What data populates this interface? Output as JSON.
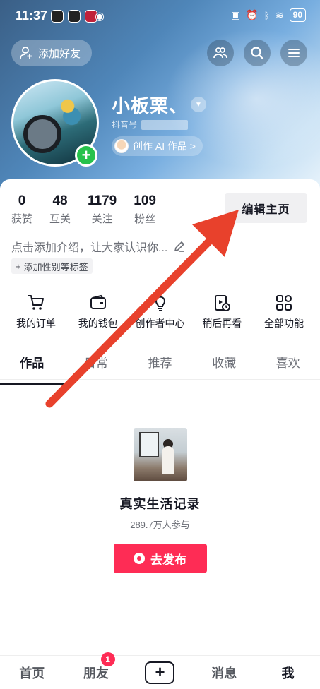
{
  "status_bar": {
    "time": "11:37",
    "battery": "90"
  },
  "header": {
    "add_friend_label": "添加好友"
  },
  "profile": {
    "nickname": "小板栗、",
    "douyin_id_prefix": "抖音号",
    "ai_chip_label": "创作 AI 作品 >"
  },
  "stats": [
    {
      "value": "0",
      "label": "获赞"
    },
    {
      "value": "48",
      "label": "互关"
    },
    {
      "value": "1179",
      "label": "关注"
    },
    {
      "value": "109",
      "label": "粉丝"
    }
  ],
  "edit_button_label": "编辑主页",
  "bio_placeholder": "点击添加介绍，让大家认识你...",
  "tag_chip_label": "添加性别等标签",
  "functions": [
    {
      "label": "我的订单",
      "icon": "cart-icon"
    },
    {
      "label": "我的钱包",
      "icon": "wallet-icon"
    },
    {
      "label": "创作者中心",
      "icon": "bulb-icon"
    },
    {
      "label": "稍后再看",
      "icon": "watch-later-icon"
    },
    {
      "label": "全部功能",
      "icon": "grid-icon"
    }
  ],
  "tabs": [
    {
      "label": "作品",
      "active": true
    },
    {
      "label": "日常",
      "active": false
    },
    {
      "label": "推荐",
      "active": false
    },
    {
      "label": "收藏",
      "active": false
    },
    {
      "label": "喜欢",
      "active": false
    }
  ],
  "empty_state": {
    "topic_title": "真实生活记录",
    "topic_sub": "289.7万人参与",
    "publish_label": "去发布"
  },
  "bottom_nav": [
    {
      "label": "首页",
      "active": false
    },
    {
      "label": "朋友",
      "active": false,
      "badge": "1"
    },
    {
      "label": "+",
      "active": false
    },
    {
      "label": "消息",
      "active": false
    },
    {
      "label": "我",
      "active": true
    }
  ],
  "colors": {
    "accent": "#fe2c55",
    "annotation_arrow": "#e8412c",
    "online_plus": "#27c24c"
  }
}
